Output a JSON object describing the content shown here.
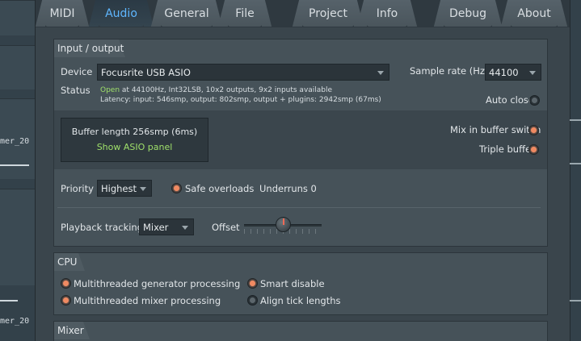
{
  "background": {
    "track_labels": [
      "mer_20",
      "mer_20"
    ]
  },
  "tabs": [
    {
      "label": "MIDI",
      "active": false
    },
    {
      "label": "Audio",
      "active": true
    },
    {
      "label": "General",
      "active": false
    },
    {
      "label": "File",
      "active": false
    },
    {
      "label": "Project",
      "active": false
    },
    {
      "label": "Info",
      "active": false
    },
    {
      "label": "Debug",
      "active": false
    },
    {
      "label": "About",
      "active": false
    }
  ],
  "io": {
    "title": "Input / output",
    "device_label": "Device",
    "device_value": "Focusrite USB ASIO",
    "sample_rate_label": "Sample rate (Hz)",
    "sample_rate_value": "44100",
    "status_label": "Status",
    "status_open": "Open",
    "status_line1": "at 44100Hz, Int32LSB, 10x2 outputs, 9x2 inputs available",
    "status_line2": "Latency: input: 546smp, output: 802smp, output + plugins: 2942smp (67ms)",
    "auto_close_label": "Auto close",
    "buffer_length": "Buffer length 256smp (6ms)",
    "show_asio_panel": "Show ASIO panel",
    "mix_in_buffer_switch": "Mix in buffer switch",
    "triple_buffer": "Triple buffer",
    "priority_label": "Priority",
    "priority_value": "Highest",
    "safe_overloads": "Safe overloads",
    "underruns": "Underruns 0",
    "playback_tracking_label": "Playback tracking",
    "playback_tracking_value": "Mixer",
    "offset_label": "Offset",
    "offset_value": 0.5
  },
  "cpu": {
    "title": "CPU",
    "multithreaded_generator": "Multithreaded generator processing",
    "multithreaded_mixer": "Multithreaded mixer processing",
    "smart_disable": "Smart disable",
    "align_tick_lengths": "Align tick lengths"
  },
  "mixer": {
    "title": "Mixer"
  },
  "colors": {
    "accent": "#5fb7ff",
    "radio_on": "#f08a62",
    "status_green": "#9fe06a"
  }
}
